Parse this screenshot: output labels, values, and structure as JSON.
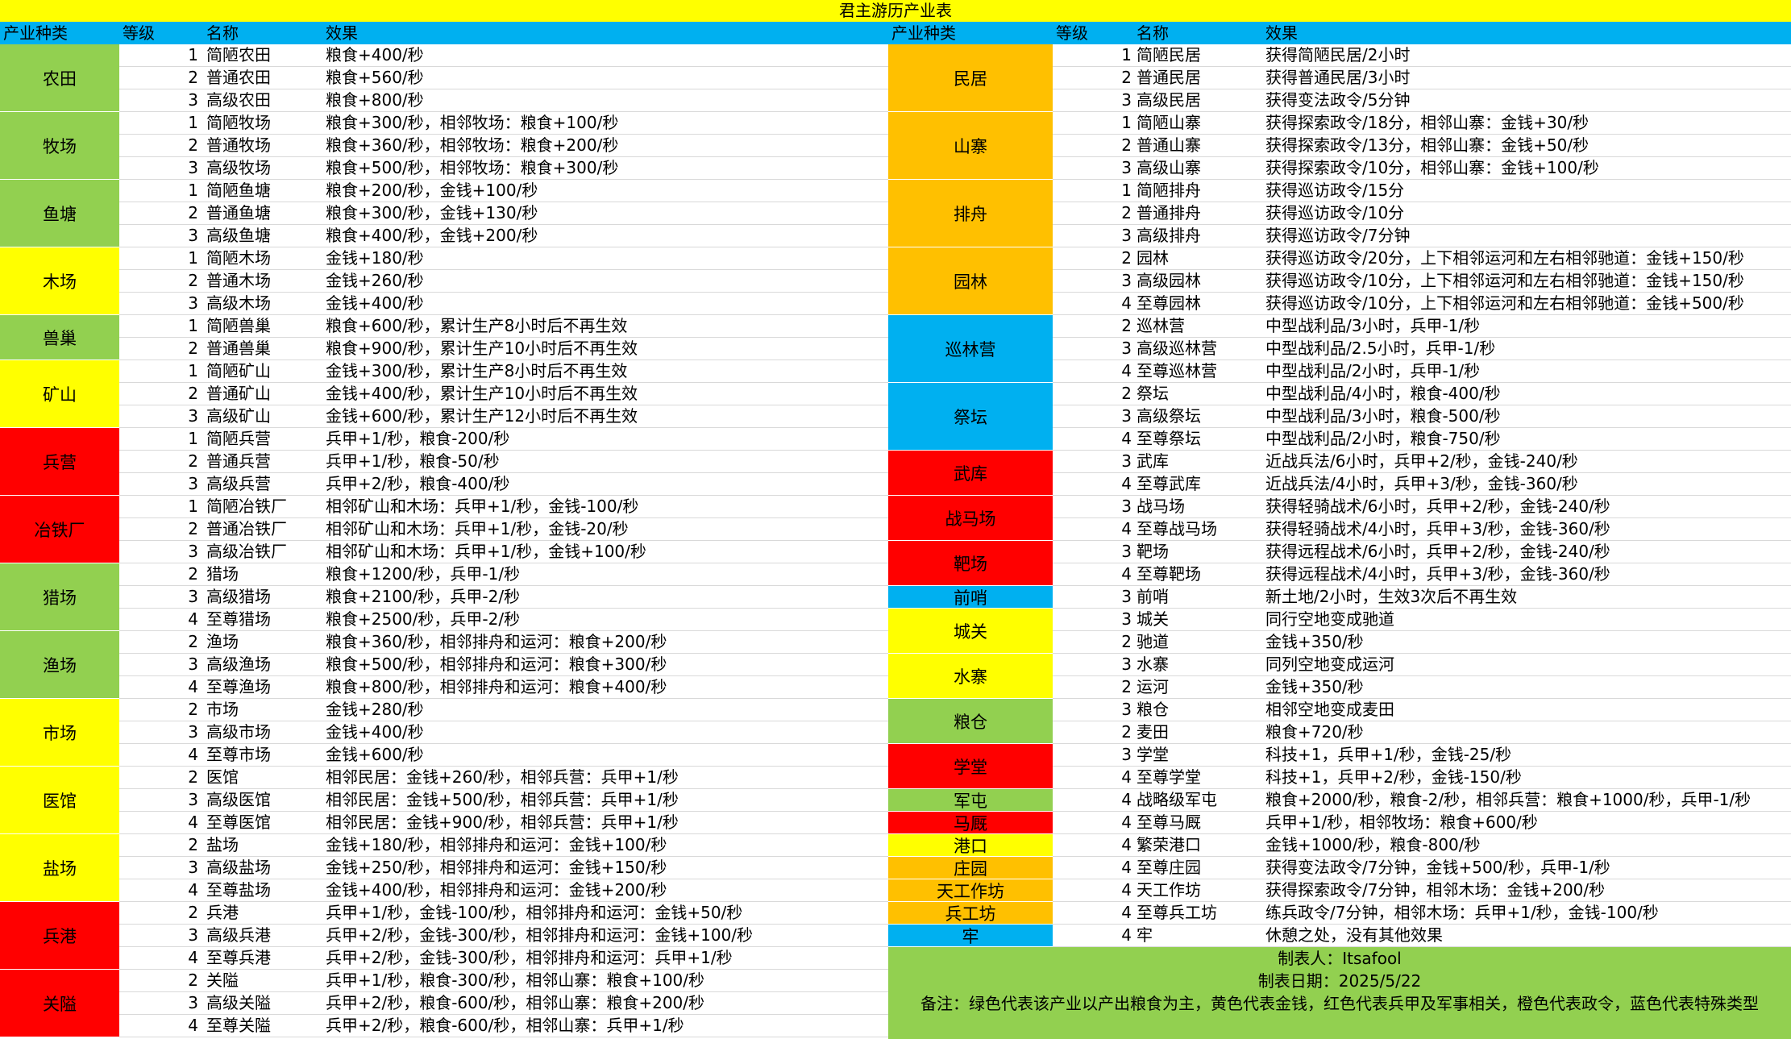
{
  "title": "君主游历产业表",
  "headers": {
    "category": "产业种类",
    "level": "等级",
    "name": "名称",
    "effect": "效果"
  },
  "colors": {
    "green": "#92d050",
    "yellow": "#ffff00",
    "red": "#ff0000",
    "orange": "#ffc000",
    "blue": "#00b0f0"
  },
  "left": {
    "categories": [
      {
        "name": "农田",
        "rows": 3,
        "color": "green"
      },
      {
        "name": "牧场",
        "rows": 3,
        "color": "green"
      },
      {
        "name": "鱼塘",
        "rows": 3,
        "color": "green"
      },
      {
        "name": "木场",
        "rows": 3,
        "color": "yellow"
      },
      {
        "name": "兽巢",
        "rows": 2,
        "color": "green"
      },
      {
        "name": "矿山",
        "rows": 3,
        "color": "yellow"
      },
      {
        "name": "兵营",
        "rows": 3,
        "color": "red"
      },
      {
        "name": "冶铁厂",
        "rows": 3,
        "color": "red"
      },
      {
        "name": "猎场",
        "rows": 3,
        "color": "green"
      },
      {
        "name": "渔场",
        "rows": 3,
        "color": "green"
      },
      {
        "name": "市场",
        "rows": 3,
        "color": "yellow"
      },
      {
        "name": "医馆",
        "rows": 3,
        "color": "yellow"
      },
      {
        "name": "盐场",
        "rows": 3,
        "color": "yellow"
      },
      {
        "name": "兵港",
        "rows": 3,
        "color": "red"
      },
      {
        "name": "关隘",
        "rows": 3,
        "color": "red"
      }
    ],
    "rows": [
      {
        "level": "1",
        "name": "简陋农田",
        "effect": "粮食+400/秒"
      },
      {
        "level": "2",
        "name": "普通农田",
        "effect": "粮食+560/秒"
      },
      {
        "level": "3",
        "name": "高级农田",
        "effect": "粮食+800/秒"
      },
      {
        "level": "1",
        "name": "简陋牧场",
        "effect": "粮食+300/秒，相邻牧场：粮食+100/秒"
      },
      {
        "level": "2",
        "name": "普通牧场",
        "effect": "粮食+360/秒，相邻牧场：粮食+200/秒"
      },
      {
        "level": "3",
        "name": "高级牧场",
        "effect": "粮食+500/秒，相邻牧场：粮食+300/秒"
      },
      {
        "level": "1",
        "name": "简陋鱼塘",
        "effect": "粮食+200/秒，金钱+100/秒"
      },
      {
        "level": "2",
        "name": "普通鱼塘",
        "effect": "粮食+300/秒，金钱+130/秒"
      },
      {
        "level": "3",
        "name": "高级鱼塘",
        "effect": "粮食+400/秒，金钱+200/秒"
      },
      {
        "level": "1",
        "name": "简陋木场",
        "effect": "金钱+180/秒"
      },
      {
        "level": "2",
        "name": "普通木场",
        "effect": "金钱+260/秒"
      },
      {
        "level": "3",
        "name": "高级木场",
        "effect": "金钱+400/秒"
      },
      {
        "level": "1",
        "name": "简陋兽巢",
        "effect": "粮食+600/秒，累计生产8小时后不再生效"
      },
      {
        "level": "2",
        "name": "普通兽巢",
        "effect": "粮食+900/秒，累计生产10小时后不再生效"
      },
      {
        "level": "1",
        "name": "简陋矿山",
        "effect": "金钱+300/秒，累计生产8小时后不再生效"
      },
      {
        "level": "2",
        "name": "普通矿山",
        "effect": "金钱+400/秒，累计生产10小时后不再生效"
      },
      {
        "level": "3",
        "name": "高级矿山",
        "effect": "金钱+600/秒，累计生产12小时后不再生效"
      },
      {
        "level": "1",
        "name": "简陋兵营",
        "effect": "兵甲+1/秒，粮食-200/秒"
      },
      {
        "level": "2",
        "name": "普通兵营",
        "effect": "兵甲+1/秒，粮食-50/秒"
      },
      {
        "level": "3",
        "name": "高级兵营",
        "effect": "兵甲+2/秒，粮食-400/秒"
      },
      {
        "level": "1",
        "name": "简陋冶铁厂",
        "effect": "相邻矿山和木场：兵甲+1/秒，金钱-100/秒"
      },
      {
        "level": "2",
        "name": "普通冶铁厂",
        "effect": "相邻矿山和木场：兵甲+1/秒，金钱-20/秒"
      },
      {
        "level": "3",
        "name": "高级冶铁厂",
        "effect": "相邻矿山和木场：兵甲+1/秒，金钱+100/秒"
      },
      {
        "level": "2",
        "name": "猎场",
        "effect": "粮食+1200/秒，兵甲-1/秒"
      },
      {
        "level": "3",
        "name": "高级猎场",
        "effect": "粮食+2100/秒，兵甲-2/秒"
      },
      {
        "level": "4",
        "name": "至尊猎场",
        "effect": "粮食+2500/秒，兵甲-2/秒"
      },
      {
        "level": "2",
        "name": "渔场",
        "effect": "粮食+360/秒，相邻排舟和运河：粮食+200/秒"
      },
      {
        "level": "3",
        "name": "高级渔场",
        "effect": "粮食+500/秒，相邻排舟和运河：粮食+300/秒"
      },
      {
        "level": "4",
        "name": "至尊渔场",
        "effect": "粮食+800/秒，相邻排舟和运河：粮食+400/秒"
      },
      {
        "level": "2",
        "name": "市场",
        "effect": "金钱+280/秒"
      },
      {
        "level": "3",
        "name": "高级市场",
        "effect": "金钱+400/秒"
      },
      {
        "level": "4",
        "name": "至尊市场",
        "effect": "金钱+600/秒"
      },
      {
        "level": "2",
        "name": "医馆",
        "effect": "相邻民居：金钱+260/秒，相邻兵营：兵甲+1/秒"
      },
      {
        "level": "3",
        "name": "高级医馆",
        "effect": "相邻民居：金钱+500/秒，相邻兵营：兵甲+1/秒"
      },
      {
        "level": "4",
        "name": "至尊医馆",
        "effect": "相邻民居：金钱+900/秒，相邻兵营：兵甲+1/秒"
      },
      {
        "level": "2",
        "name": "盐场",
        "effect": "金钱+180/秒，相邻排舟和运河：金钱+100/秒"
      },
      {
        "level": "3",
        "name": "高级盐场",
        "effect": "金钱+250/秒，相邻排舟和运河：金钱+150/秒"
      },
      {
        "level": "4",
        "name": "至尊盐场",
        "effect": "金钱+400/秒，相邻排舟和运河：金钱+200/秒"
      },
      {
        "level": "2",
        "name": "兵港",
        "effect": "兵甲+1/秒，金钱-100/秒，相邻排舟和运河：金钱+50/秒"
      },
      {
        "level": "3",
        "name": "高级兵港",
        "effect": "兵甲+2/秒，金钱-300/秒，相邻排舟和运河：金钱+100/秒"
      },
      {
        "level": "4",
        "name": "至尊兵港",
        "effect": "兵甲+2/秒，金钱-300/秒，相邻排舟和运河：兵甲+1/秒"
      },
      {
        "level": "2",
        "name": "关隘",
        "effect": "兵甲+1/秒，粮食-300/秒，相邻山寨：粮食+100/秒"
      },
      {
        "level": "3",
        "name": "高级关隘",
        "effect": "兵甲+2/秒，粮食-600/秒，相邻山寨：粮食+200/秒"
      },
      {
        "level": "4",
        "name": "至尊关隘",
        "effect": "兵甲+2/秒，粮食-600/秒，相邻山寨：兵甲+1/秒"
      }
    ]
  },
  "right": {
    "categories": [
      {
        "name": "民居",
        "rows": 3,
        "color": "orange"
      },
      {
        "name": "山寨",
        "rows": 3,
        "color": "orange"
      },
      {
        "name": "排舟",
        "rows": 3,
        "color": "orange"
      },
      {
        "name": "园林",
        "rows": 3,
        "color": "orange"
      },
      {
        "name": "巡林营",
        "rows": 3,
        "color": "blue"
      },
      {
        "name": "祭坛",
        "rows": 3,
        "color": "blue"
      },
      {
        "name": "武库",
        "rows": 2,
        "color": "red"
      },
      {
        "name": "战马场",
        "rows": 2,
        "color": "red"
      },
      {
        "name": "靶场",
        "rows": 2,
        "color": "red"
      },
      {
        "name": "前哨",
        "rows": 1,
        "color": "blue"
      },
      {
        "name": "城关",
        "rows": 2,
        "color": "yellow"
      },
      {
        "name": "水寨",
        "rows": 2,
        "color": "yellow"
      },
      {
        "name": "粮仓",
        "rows": 2,
        "color": "green"
      },
      {
        "name": "学堂",
        "rows": 2,
        "color": "red"
      },
      {
        "name": "军屯",
        "rows": 1,
        "color": "green"
      },
      {
        "name": "马厩",
        "rows": 1,
        "color": "red"
      },
      {
        "name": "港口",
        "rows": 1,
        "color": "yellow"
      },
      {
        "name": "庄园",
        "rows": 1,
        "color": "orange"
      },
      {
        "name": "天工作坊",
        "rows": 1,
        "color": "orange"
      },
      {
        "name": "兵工坊",
        "rows": 1,
        "color": "orange"
      },
      {
        "name": "牢",
        "rows": 1,
        "color": "blue"
      }
    ],
    "rows": [
      {
        "level": "1",
        "name": "简陋民居",
        "effect": "获得简陋民居/2小时"
      },
      {
        "level": "2",
        "name": "普通民居",
        "effect": "获得普通民居/3小时"
      },
      {
        "level": "3",
        "name": "高级民居",
        "effect": "获得变法政令/5分钟"
      },
      {
        "level": "1",
        "name": "简陋山寨",
        "effect": "获得探索政令/18分，相邻山寨：金钱+30/秒"
      },
      {
        "level": "2",
        "name": "普通山寨",
        "effect": "获得探索政令/13分，相邻山寨：金钱+50/秒"
      },
      {
        "level": "3",
        "name": "高级山寨",
        "effect": "获得探索政令/10分，相邻山寨：金钱+100/秒"
      },
      {
        "level": "1",
        "name": "简陋排舟",
        "effect": "获得巡访政令/15分"
      },
      {
        "level": "2",
        "name": "普通排舟",
        "effect": "获得巡访政令/10分"
      },
      {
        "level": "3",
        "name": "高级排舟",
        "effect": "获得巡访政令/7分钟"
      },
      {
        "level": "2",
        "name": "园林",
        "effect": "获得巡访政令/20分，上下相邻运河和左右相邻驰道：金钱+150/秒"
      },
      {
        "level": "3",
        "name": "高级园林",
        "effect": "获得巡访政令/10分，上下相邻运河和左右相邻驰道：金钱+150/秒"
      },
      {
        "level": "4",
        "name": "至尊园林",
        "effect": "获得巡访政令/10分，上下相邻运河和左右相邻驰道：金钱+500/秒"
      },
      {
        "level": "2",
        "name": "巡林营",
        "effect": "中型战利品/3小时，兵甲-1/秒"
      },
      {
        "level": "3",
        "name": "高级巡林营",
        "effect": "中型战利品/2.5小时，兵甲-1/秒"
      },
      {
        "level": "4",
        "name": "至尊巡林营",
        "effect": "中型战利品/2小时，兵甲-1/秒"
      },
      {
        "level": "2",
        "name": "祭坛",
        "effect": "中型战利品/4小时，粮食-400/秒"
      },
      {
        "level": "3",
        "name": "高级祭坛",
        "effect": "中型战利品/3小时，粮食-500/秒"
      },
      {
        "level": "4",
        "name": "至尊祭坛",
        "effect": "中型战利品/2小时，粮食-750/秒"
      },
      {
        "level": "3",
        "name": "武库",
        "effect": "近战兵法/6小时，兵甲+2/秒，金钱-240/秒"
      },
      {
        "level": "4",
        "name": "至尊武库",
        "effect": "近战兵法/4小时，兵甲+3/秒，金钱-360/秒"
      },
      {
        "level": "3",
        "name": "战马场",
        "effect": "获得轻骑战术/6小时，兵甲+2/秒，金钱-240/秒"
      },
      {
        "level": "4",
        "name": "至尊战马场",
        "effect": "获得轻骑战术/4小时，兵甲+3/秒，金钱-360/秒"
      },
      {
        "level": "3",
        "name": "靶场",
        "effect": "获得远程战术/6小时，兵甲+2/秒，金钱-240/秒"
      },
      {
        "level": "4",
        "name": "至尊靶场",
        "effect": "获得远程战术/4小时，兵甲+3/秒，金钱-360/秒"
      },
      {
        "level": "3",
        "name": "前哨",
        "effect": "新土地/2小时，生效3次后不再生效"
      },
      {
        "level": "3",
        "name": "城关",
        "effect": "同行空地变成驰道"
      },
      {
        "level": "2",
        "name": "驰道",
        "effect": "金钱+350/秒"
      },
      {
        "level": "3",
        "name": "水寨",
        "effect": "同列空地变成运河"
      },
      {
        "level": "2",
        "name": "运河",
        "effect": "金钱+350/秒"
      },
      {
        "level": "3",
        "name": "粮仓",
        "effect": "相邻空地变成麦田"
      },
      {
        "level": "2",
        "name": "麦田",
        "effect": "粮食+720/秒"
      },
      {
        "level": "3",
        "name": "学堂",
        "effect": "科技+1，兵甲+1/秒，金钱-25/秒"
      },
      {
        "level": "4",
        "name": "至尊学堂",
        "effect": "科技+1，兵甲+2/秒，金钱-150/秒"
      },
      {
        "level": "4",
        "name": "战略级军屯",
        "effect": "粮食+2000/秒，粮食-2/秒，相邻兵营：粮食+1000/秒，兵甲-1/秒"
      },
      {
        "level": "4",
        "name": "至尊马厩",
        "effect": "兵甲+1/秒，相邻牧场：粮食+600/秒"
      },
      {
        "level": "4",
        "name": "繁荣港口",
        "effect": "金钱+1000/秒，粮食-800/秒"
      },
      {
        "level": "4",
        "name": "至尊庄园",
        "effect": "获得变法政令/7分钟，金钱+500/秒，兵甲-1/秒"
      },
      {
        "level": "4",
        "name": "天工作坊",
        "effect": "获得探索政令/7分钟，相邻木场：金钱+200/秒"
      },
      {
        "level": "4",
        "name": "至尊兵工坊",
        "effect": "练兵政令/7分钟，相邻木场：兵甲+1/秒，金钱-100/秒"
      },
      {
        "level": "4",
        "name": "牢",
        "effect": "休憩之处，没有其他效果"
      }
    ]
  },
  "notes": {
    "maker": "制表人：Itsafool",
    "date": "制表日期：2025/5/22",
    "remark": "备注：绿色代表该产业以产出粮食为主，黄色代表金钱，红色代表兵甲及军事相关，橙色代表政令，蓝色代表特殊类型"
  }
}
